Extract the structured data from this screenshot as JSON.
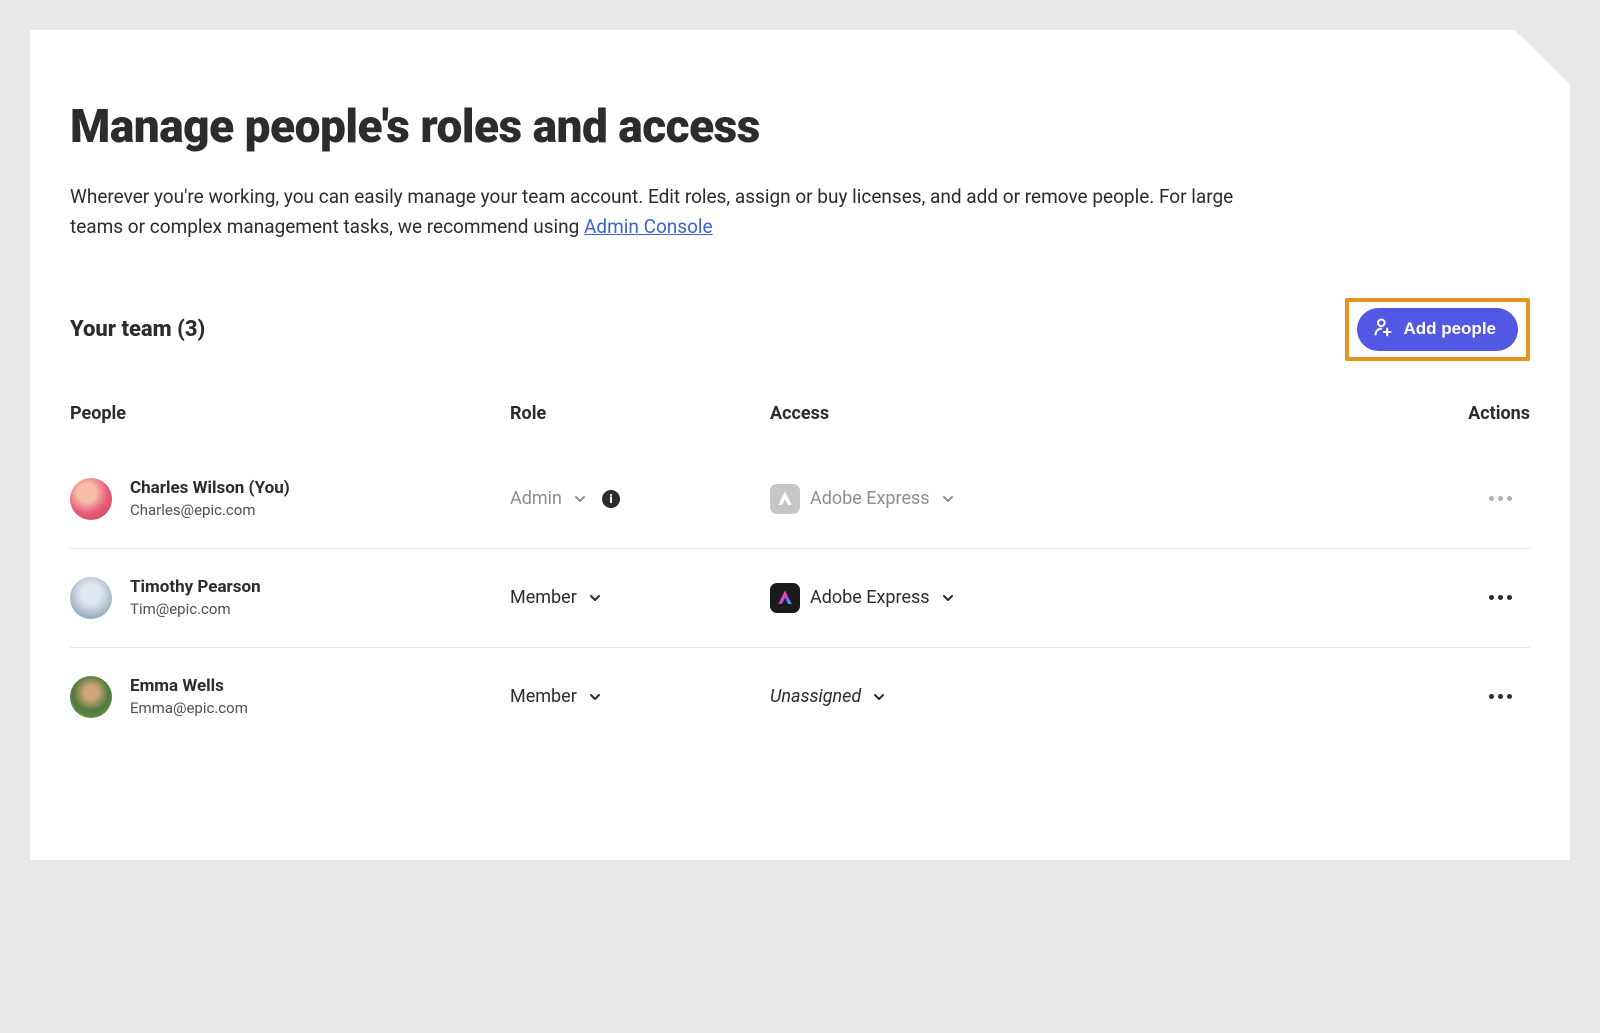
{
  "header": {
    "title": "Manage people's roles and access",
    "description_pre": "Wherever you're working, you can easily manage your team account. Edit roles, assign or buy licenses, and add or remove people. For large teams or complex management tasks, we recommend using ",
    "admin_link_label": "Admin Console"
  },
  "team": {
    "header_label": "Your team (3)",
    "count": 3,
    "add_button_label": "Add people"
  },
  "columns": {
    "people": "People",
    "role": "Role",
    "access": "Access",
    "actions": "Actions"
  },
  "rows": [
    {
      "name": "Charles Wilson (You)",
      "email": "Charles@epic.com",
      "role": "Admin",
      "role_disabled": true,
      "show_info": true,
      "access": "Adobe Express",
      "access_disabled": true,
      "access_icon_tone": "grey",
      "access_unassigned": false,
      "actions_disabled": true
    },
    {
      "name": "Timothy Pearson",
      "email": "Tim@epic.com",
      "role": "Member",
      "role_disabled": false,
      "show_info": false,
      "access": "Adobe Express",
      "access_disabled": false,
      "access_icon_tone": "dark",
      "access_unassigned": false,
      "actions_disabled": false
    },
    {
      "name": "Emma Wells",
      "email": "Emma@epic.com",
      "role": "Member",
      "role_disabled": false,
      "show_info": false,
      "access": "Unassigned",
      "access_disabled": false,
      "access_icon_tone": "",
      "access_unassigned": true,
      "actions_disabled": false
    }
  ]
}
